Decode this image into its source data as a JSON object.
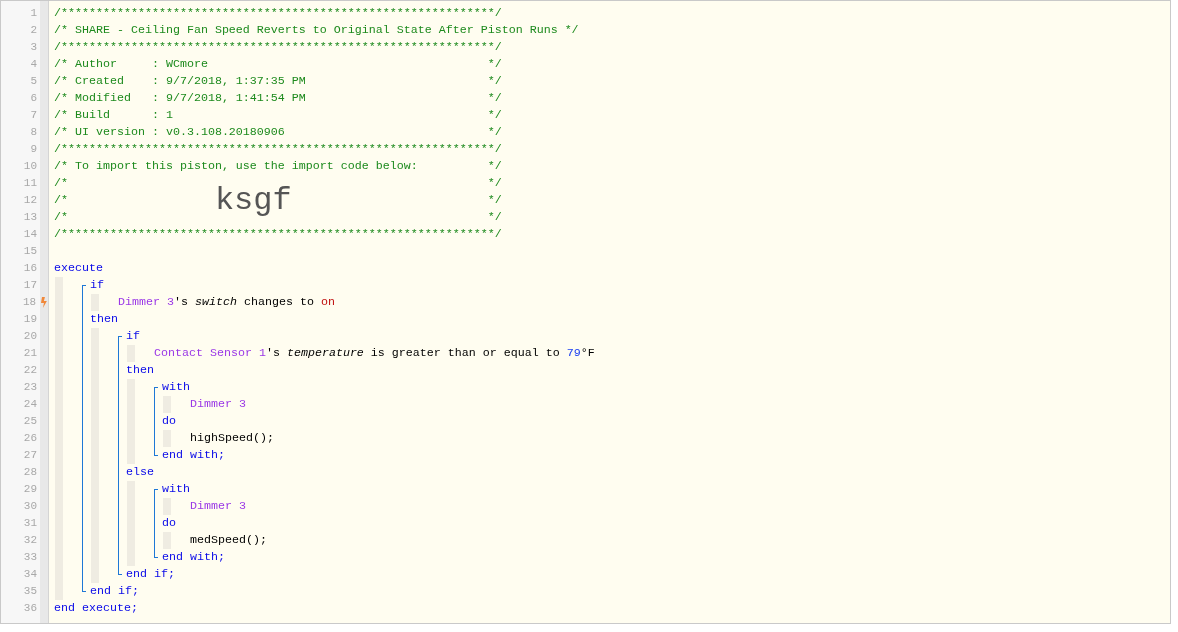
{
  "editor": {
    "header": [
      {
        "number": "1",
        "text": "/**************************************************************/"
      },
      {
        "number": "2",
        "text": "/* SHARE - Ceiling Fan Speed Reverts to Original State After Piston Runs */"
      },
      {
        "number": "3",
        "text": "/**************************************************************/"
      },
      {
        "number": "4",
        "text": "/* Author     : WCmore",
        "end": "*/"
      },
      {
        "number": "5",
        "text": "/* Created    : 9/7/2018, 1:37:35 PM",
        "end": "*/"
      },
      {
        "number": "6",
        "text": "/* Modified   : 9/7/2018, 1:41:54 PM",
        "end": "*/"
      },
      {
        "number": "7",
        "text": "/* Build      : 1",
        "end": "*/"
      },
      {
        "number": "8",
        "text": "/* UI version : v0.3.108.20180906",
        "end": "*/"
      },
      {
        "number": "9",
        "text": "/**************************************************************/"
      },
      {
        "number": "10",
        "text": "/* To import this piston, use the import code below:",
        "end": "*/"
      },
      {
        "number": "11",
        "text": "/*",
        "end": "*/"
      },
      {
        "number": "12",
        "text": "/*",
        "code": "ksgf",
        "end": "*/"
      },
      {
        "number": "13",
        "text": "/*",
        "end": "*/"
      },
      {
        "number": "14",
        "text": "/**************************************************************/"
      },
      {
        "number": "15"
      }
    ],
    "code": [
      {
        "kind": "line",
        "number": "16",
        "trigger": false,
        "tokens": [
          {
            "kind": "keyword",
            "text": "execute"
          }
        ]
      },
      {
        "kind": "indent",
        "children": [
          {
            "kind": "bracket",
            "children": [
              {
                "kind": "line",
                "number": "17",
                "trigger": false,
                "tokens": [
                  {
                    "kind": "keyword",
                    "text": "if"
                  }
                ]
              },
              {
                "kind": "indent",
                "children": [
                  {
                    "kind": "line",
                    "number": "18",
                    "trigger": true,
                    "tokens": [
                      {
                        "kind": "device",
                        "text": "Dimmer 3"
                      },
                      {
                        "kind": "plain",
                        "text": "'s "
                      },
                      {
                        "kind": "attribute",
                        "text": "switch"
                      },
                      {
                        "kind": "plain",
                        "text": " changes to "
                      },
                      {
                        "kind": "value",
                        "text": "on"
                      }
                    ]
                  }
                ]
              },
              {
                "kind": "line",
                "number": "19",
                "trigger": false,
                "tokens": [
                  {
                    "kind": "keyword",
                    "text": "then"
                  }
                ]
              },
              {
                "kind": "indent",
                "children": [
                  {
                    "kind": "bracket",
                    "children": [
                      {
                        "kind": "line",
                        "number": "20",
                        "trigger": false,
                        "tokens": [
                          {
                            "kind": "keyword",
                            "text": "if"
                          }
                        ]
                      },
                      {
                        "kind": "indent",
                        "children": [
                          {
                            "kind": "line",
                            "number": "21",
                            "trigger": false,
                            "tokens": [
                              {
                                "kind": "device",
                                "text": "Contact Sensor 1"
                              },
                              {
                                "kind": "plain",
                                "text": "'s "
                              },
                              {
                                "kind": "attribute",
                                "text": "temperature"
                              },
                              {
                                "kind": "plain",
                                "text": " is greater than or equal to "
                              },
                              {
                                "kind": "number",
                                "text": "79"
                              },
                              {
                                "kind": "plain",
                                "text": "°F"
                              }
                            ]
                          }
                        ]
                      },
                      {
                        "kind": "line",
                        "number": "22",
                        "trigger": false,
                        "tokens": [
                          {
                            "kind": "keyword",
                            "text": "then"
                          }
                        ]
                      },
                      {
                        "kind": "indent",
                        "children": [
                          {
                            "kind": "bracket",
                            "children": [
                              {
                                "kind": "line",
                                "number": "23",
                                "trigger": false,
                                "tokens": [
                                  {
                                    "kind": "keyword",
                                    "text": "with"
                                  }
                                ]
                              },
                              {
                                "kind": "indent",
                                "children": [
                                  {
                                    "kind": "line",
                                    "number": "24",
                                    "trigger": false,
                                    "tokens": [
                                      {
                                        "kind": "device",
                                        "text": "Dimmer 3"
                                      }
                                    ]
                                  }
                                ]
                              },
                              {
                                "kind": "line",
                                "number": "25",
                                "trigger": false,
                                "tokens": [
                                  {
                                    "kind": "keyword",
                                    "text": "do"
                                  }
                                ]
                              },
                              {
                                "kind": "indent",
                                "children": [
                                  {
                                    "kind": "line",
                                    "number": "26",
                                    "trigger": false,
                                    "tokens": [
                                      {
                                        "kind": "plain",
                                        "text": "highSpeed();"
                                      }
                                    ]
                                  }
                                ]
                              },
                              {
                                "kind": "line",
                                "number": "27",
                                "trigger": false,
                                "tokens": [
                                  {
                                    "kind": "keyword",
                                    "text": "end with;"
                                  }
                                ]
                              }
                            ]
                          }
                        ]
                      },
                      {
                        "kind": "line",
                        "number": "28",
                        "trigger": false,
                        "tokens": [
                          {
                            "kind": "keyword",
                            "text": "else"
                          }
                        ]
                      },
                      {
                        "kind": "indent",
                        "children": [
                          {
                            "kind": "bracket",
                            "children": [
                              {
                                "kind": "line",
                                "number": "29",
                                "trigger": false,
                                "tokens": [
                                  {
                                    "kind": "keyword",
                                    "text": "with"
                                  }
                                ]
                              },
                              {
                                "kind": "indent",
                                "children": [
                                  {
                                    "kind": "line",
                                    "number": "30",
                                    "trigger": false,
                                    "tokens": [
                                      {
                                        "kind": "device",
                                        "text": "Dimmer 3"
                                      }
                                    ]
                                  }
                                ]
                              },
                              {
                                "kind": "line",
                                "number": "31",
                                "trigger": false,
                                "tokens": [
                                  {
                                    "kind": "keyword",
                                    "text": "do"
                                  }
                                ]
                              },
                              {
                                "kind": "indent",
                                "children": [
                                  {
                                    "kind": "line",
                                    "number": "32",
                                    "trigger": false,
                                    "tokens": [
                                      {
                                        "kind": "plain",
                                        "text": "medSpeed();"
                                      }
                                    ]
                                  }
                                ]
                              },
                              {
                                "kind": "line",
                                "number": "33",
                                "trigger": false,
                                "tokens": [
                                  {
                                    "kind": "keyword",
                                    "text": "end with;"
                                  }
                                ]
                              }
                            ]
                          }
                        ]
                      },
                      {
                        "kind": "line",
                        "number": "34",
                        "trigger": false,
                        "tokens": [
                          {
                            "kind": "keyword",
                            "text": "end if;"
                          }
                        ]
                      }
                    ]
                  }
                ]
              },
              {
                "kind": "line",
                "number": "35",
                "trigger": false,
                "tokens": [
                  {
                    "kind": "keyword",
                    "text": "end if;"
                  }
                ]
              }
            ]
          }
        ]
      },
      {
        "kind": "line",
        "number": "36",
        "trigger": false,
        "tokens": [
          {
            "kind": "keyword",
            "text": "end execute;"
          }
        ]
      }
    ]
  }
}
